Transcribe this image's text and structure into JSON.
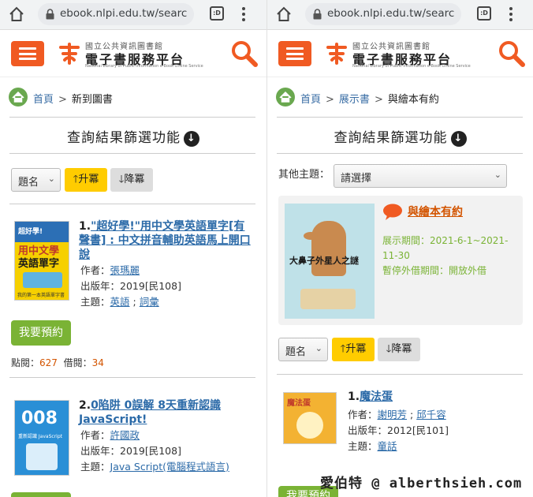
{
  "browser": {
    "url": "ebook.nlpi.edu.tw/searc",
    "tabs_label": ":D"
  },
  "site": {
    "org_name": "國立公共資訊圖書館",
    "platform_name": "電子書服務平台",
    "platform_name_en": "National Library of Public Information e-Book Online Service",
    "brand_color": "#f05a22"
  },
  "left": {
    "breadcrumb": {
      "home": "首頁",
      "sep": ">",
      "current": "新到圖書"
    },
    "filter_title": "查詢結果篩選功能",
    "sort": {
      "select_value": "題名",
      "asc_label": "升冪",
      "desc_label": "降冪"
    },
    "books": [
      {
        "num": "1.",
        "title": "\"超好學!\"用中文學英語單字[有聲書] : 中文拼音輔助英語馬上開口說",
        "author_label": "作者：",
        "author": "張瑪麗",
        "year_label": "出版年：",
        "year": "2019[民108]",
        "subject_label": "主題：",
        "subjects": [
          "英語",
          "詞彙"
        ],
        "subject_sep": ";",
        "reserve_label": "我要預約",
        "views_label": "點閱：",
        "views": "627",
        "borrows_label": "借閱：",
        "borrows": "34",
        "cover_text": [
          "超好學!",
          "用中文學",
          "英語單字",
          "我的第一本英語單字書"
        ]
      },
      {
        "num": "2.",
        "title": "0陷阱 0誤解 8天重新認識JavaScript!",
        "author_label": "作者：",
        "author": "許國政",
        "year_label": "出版年：",
        "year": "2019[民108]",
        "subject_label": "主題：",
        "subjects": [
          "Java Script(電腦程式語言)"
        ],
        "cover_text": [
          "008",
          "重新認識 JavaScript"
        ]
      }
    ]
  },
  "right": {
    "breadcrumb": {
      "home": "首頁",
      "sep": ">",
      "mid": "展示書",
      "current": "與繪本有約"
    },
    "filter_title": "查詢結果篩選功能",
    "other_topic_label": "其他主題：",
    "other_topic_value": "請選擇",
    "exhibition": {
      "title": "與繪本有約",
      "period": "展示期間：2021-6-1~2021-11-30",
      "suspend": "暫停外借期間：開放外借",
      "cover_title": "大鼻子外星人之謎"
    },
    "sort": {
      "select_value": "題名",
      "asc_label": "升冪",
      "desc_label": "降冪"
    },
    "books": [
      {
        "num": "1.",
        "title": "魔法蛋",
        "author_label": "作者：",
        "authors": [
          "謝明芳",
          "邱千容"
        ],
        "author_sep": ";",
        "year_label": "出版年：",
        "year": "2012[民101]",
        "subject_label": "主題：",
        "subjects": [
          "童話"
        ],
        "reserve_label": "我要預約",
        "cover_text": [
          "魔法蛋"
        ]
      }
    ]
  },
  "watermark": "愛伯特 @ alberthsieh.com"
}
